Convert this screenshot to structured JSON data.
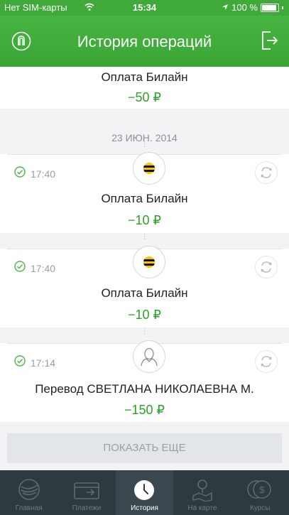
{
  "status_bar": {
    "carrier": "Нет SIM-карты",
    "time": "15:34",
    "battery": "100 %"
  },
  "header": {
    "title": "История операций"
  },
  "operations": [
    {
      "name": "Оплата Билайн",
      "amount": "−50 ₽"
    },
    {
      "time": "17:40",
      "name": "Оплата Билайн",
      "amount": "−10 ₽"
    },
    {
      "time": "17:40",
      "name": "Оплата Билайн",
      "amount": "−10 ₽"
    },
    {
      "time": "17:14",
      "name": "Перевод СВЕТЛАНА НИКОЛАЕВНА М.",
      "amount": "−150 ₽"
    }
  ],
  "date_header": "23 ИЮН. 2014",
  "show_more": "ПОКАЗАТЬ ЕЩЕ",
  "tabs": [
    {
      "label": "Главная",
      "icon": "home-icon"
    },
    {
      "label": "Платежи",
      "icon": "payments-icon"
    },
    {
      "label": "История",
      "icon": "clock-icon",
      "active": true
    },
    {
      "label": "На карте",
      "icon": "map-pin-icon"
    },
    {
      "label": "Курсы",
      "icon": "currency-icon"
    }
  ],
  "colors": {
    "brand_green": "#3faa3a",
    "amount_green": "#2fa02b",
    "tabbar_bg": "#2f3a40"
  }
}
